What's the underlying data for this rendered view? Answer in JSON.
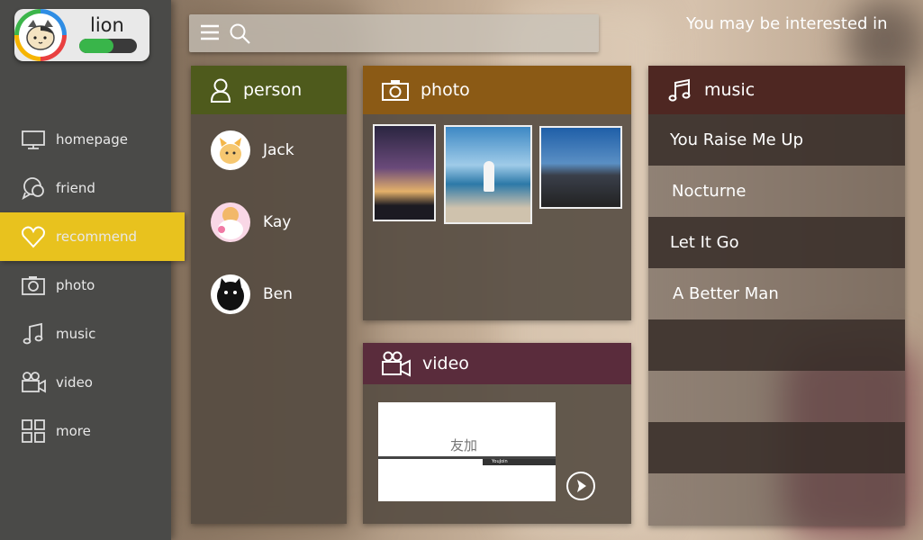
{
  "profile": {
    "username": "lion",
    "level_progress": 0.6
  },
  "nav": {
    "items": [
      {
        "label": "homepage",
        "icon": "monitor-icon"
      },
      {
        "label": "friend",
        "icon": "chat-icon"
      },
      {
        "label": "recommend",
        "icon": "heart-icon",
        "active": true
      },
      {
        "label": "photo",
        "icon": "camera-icon"
      },
      {
        "label": "music",
        "icon": "music-note-icon"
      },
      {
        "label": "video",
        "icon": "video-camera-icon"
      },
      {
        "label": "more",
        "icon": "grid-icon"
      }
    ]
  },
  "search": {
    "placeholder": ""
  },
  "header": {
    "interest_text": "You may be interested in"
  },
  "person_panel": {
    "title": "person",
    "people": [
      {
        "name": "Jack"
      },
      {
        "name": "Kay"
      },
      {
        "name": "Ben"
      }
    ]
  },
  "photo_panel": {
    "title": "photo"
  },
  "video_panel": {
    "title": "video",
    "logo_text": "友加",
    "caption": "YouJoin"
  },
  "music_panel": {
    "title": "music",
    "songs": [
      {
        "title": "You Raise Me Up"
      },
      {
        "title": "Nocturne"
      },
      {
        "title": "Let It Go"
      },
      {
        "title": "A Better Man"
      }
    ]
  },
  "colors": {
    "sidebar": "#4a4a48",
    "active": "#e8c21e",
    "person_head": "#4e5a1c",
    "photo_head": "#8b5a15",
    "video_head": "#5a2c3c",
    "music_head": "#4e2722"
  }
}
